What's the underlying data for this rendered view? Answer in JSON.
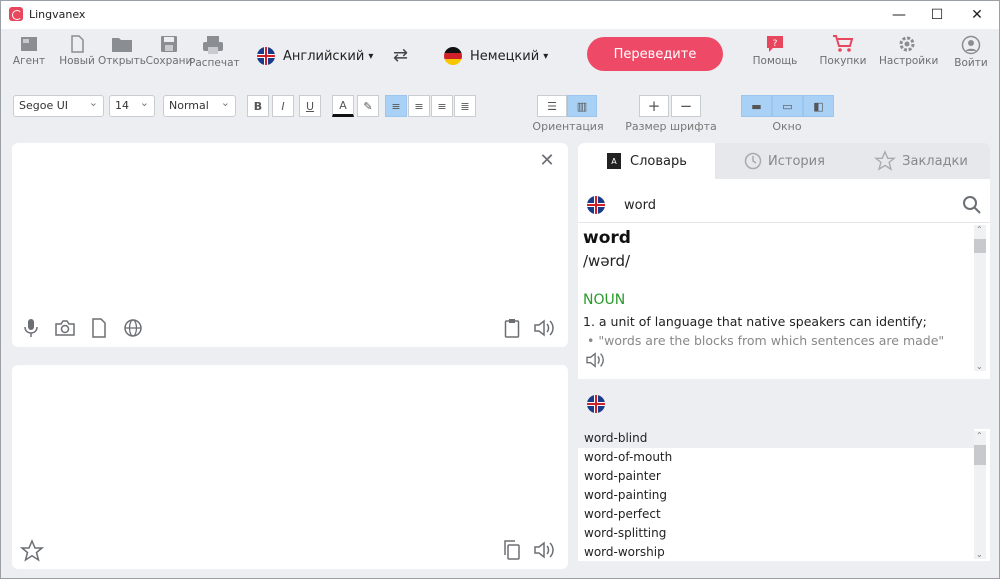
{
  "window": {
    "title": "Lingvanex",
    "minimize": "—",
    "maximize": "☐",
    "close": "✕"
  },
  "toolbar": {
    "agent": "Агент",
    "new": "Новый",
    "open": "Открыть",
    "save": "Сохрани",
    "print": "Распечат",
    "source_lang": "Английский",
    "target_lang": "Немецкий",
    "translate": "Переведите",
    "help": "Помощь",
    "purchases": "Покупки",
    "settings": "Настройки",
    "login": "Войти"
  },
  "format": {
    "font": "Segoe UI",
    "size": "14",
    "style": "Normal",
    "bold": "B",
    "italic": "I",
    "underline": "U",
    "color": "A",
    "orientation_label": "Ориентация",
    "font_size_label": "Размер шрифта",
    "plus": "+",
    "minus": "−",
    "window_label": "Окно"
  },
  "dictionary": {
    "tabs": {
      "dictionary": "Словарь",
      "history": "История",
      "bookmarks": "Закладки"
    },
    "query": "word",
    "headword": "word",
    "transcription": "/wərd/",
    "pos": "NOUN",
    "definition": "1. a unit of language that native speakers can identify;",
    "example": "• \"words are the blocks from which sentences are made\"",
    "related": [
      "word-blind",
      "word-of-mouth",
      "word-painter",
      "word-painting",
      "word-perfect",
      "word-splitting",
      "word-worship"
    ]
  },
  "colors": {
    "accent": "#ee4a67",
    "pos": "#2a9a2a",
    "active": "#a9d0f5"
  }
}
